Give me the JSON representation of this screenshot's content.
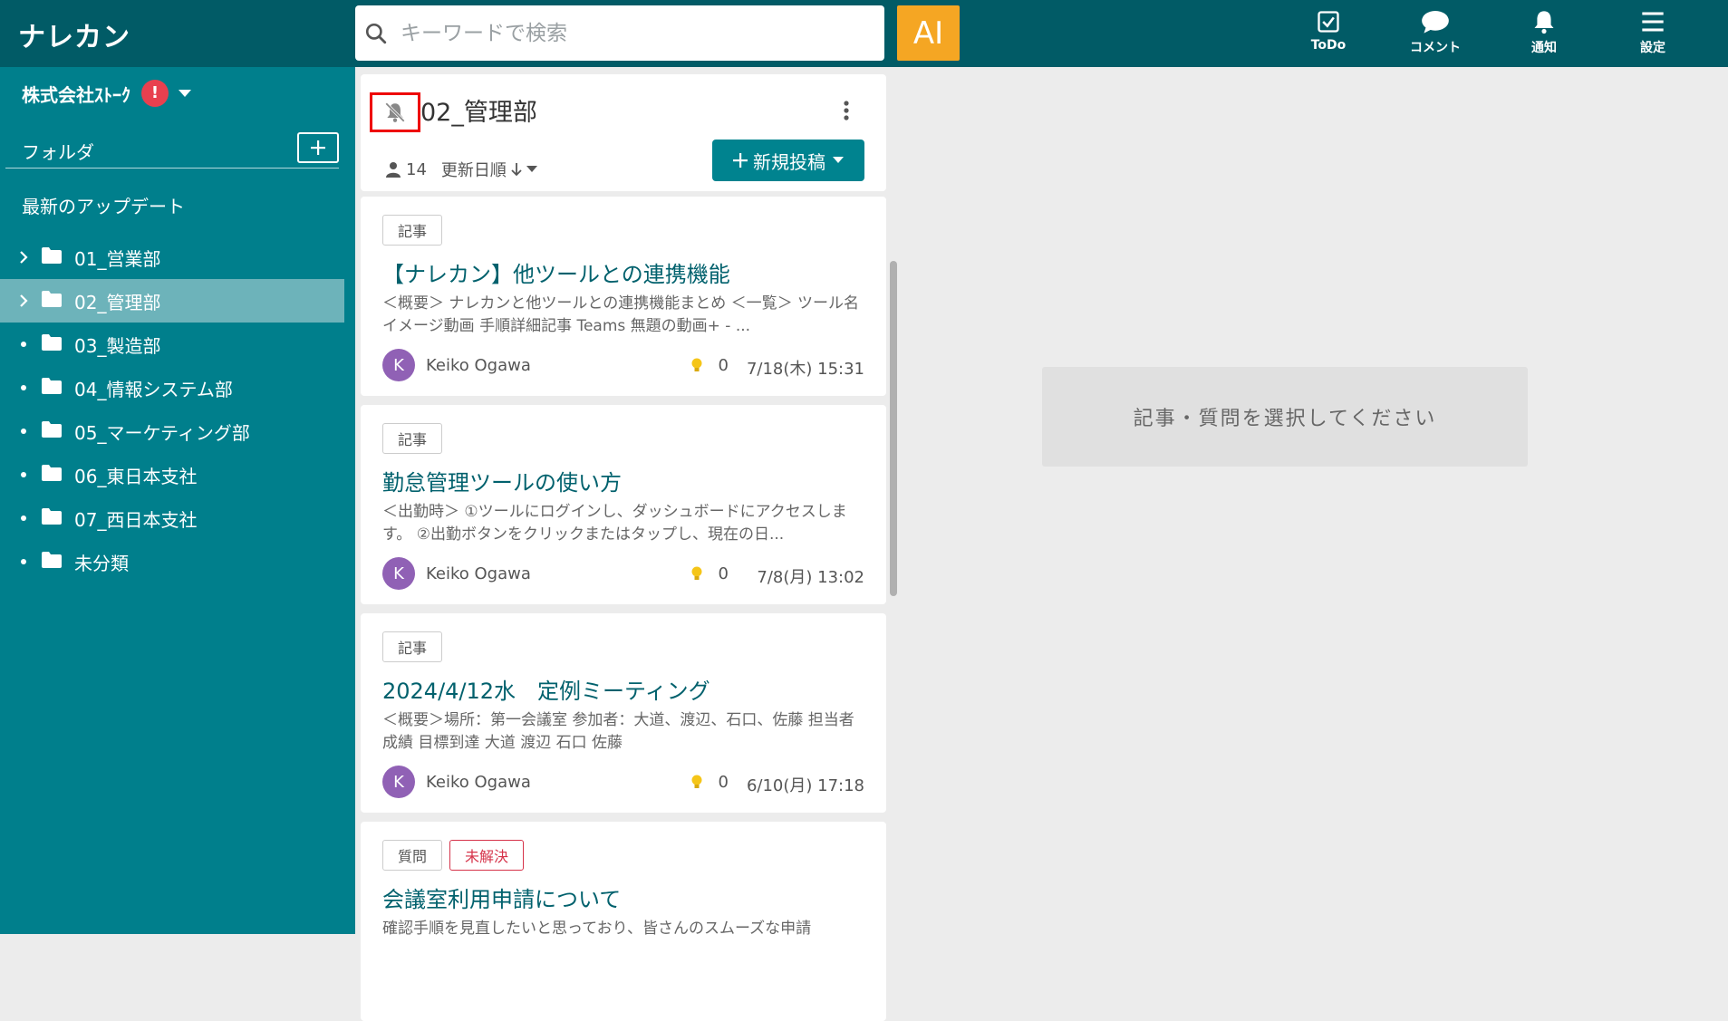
{
  "header": {
    "logo": "ナレカン",
    "search_placeholder": "キーワードで検索",
    "ai_label": "AI",
    "nav": [
      {
        "label": "ToDo",
        "icon": "todo-check-icon"
      },
      {
        "label": "コメント",
        "icon": "comment-bubble-icon"
      },
      {
        "label": "通知",
        "icon": "bell-icon"
      },
      {
        "label": "設定",
        "icon": "hamburger-menu-icon"
      }
    ]
  },
  "sidebar": {
    "company": "株式会社ｽﾄｰｸ",
    "alert_badge": "!",
    "folder_label": "フォルダ",
    "add_label": "+",
    "latest_updates": "最新のアップデート",
    "folders": [
      {
        "name": "01_営業部",
        "has_children": true,
        "active": false
      },
      {
        "name": "02_管理部",
        "has_children": true,
        "active": true
      },
      {
        "name": "03_製造部",
        "has_children": false,
        "active": false
      },
      {
        "name": "04_情報システム部",
        "has_children": false,
        "active": false
      },
      {
        "name": "05_マーケティング部",
        "has_children": false,
        "active": false
      },
      {
        "name": "06_東日本支社",
        "has_children": false,
        "active": false
      },
      {
        "name": "07_西日本支社",
        "has_children": false,
        "active": false
      },
      {
        "name": "未分類",
        "has_children": false,
        "active": false
      }
    ]
  },
  "folder_panel": {
    "title": "02_管理部",
    "member_count": "14",
    "sort_label": "更新日順",
    "new_post_label": "新規投稿"
  },
  "posts": [
    {
      "tags": [
        "記事"
      ],
      "title": "【ナレカン】他ツールとの連携機能",
      "excerpt": "＜概要＞ ナレカンと他ツールとの連携機能まとめ ＜一覧＞ ツール名 イメージ動画 手順詳細記事 Teams 無題の動画+ - ...",
      "author_initial": "K",
      "author": "Keiko Ogawa",
      "likes": "0",
      "date": "7/18(木) 15:31"
    },
    {
      "tags": [
        "記事"
      ],
      "title": "勤怠管理ツールの使い方",
      "excerpt": "＜出勤時＞ ①ツールにログインし、ダッシュボードにアクセスします。 ②出勤ボタンをクリックまたはタップし、現在の日...",
      "author_initial": "K",
      "author": "Keiko Ogawa",
      "likes": "0",
      "date": "7/8(月) 13:02"
    },
    {
      "tags": [
        "記事"
      ],
      "title": "2024/4/12水　定例ミーティング",
      "excerpt": "＜概要＞場所：第一会議室 参加者：大道、渡辺、石口、佐藤 担当者 成績 目標到達 大道 渡辺 石口 佐藤",
      "author_initial": "K",
      "author": "Keiko Ogawa",
      "likes": "0",
      "date": "6/10(月) 17:18"
    },
    {
      "tags": [
        "質問",
        "未解決"
      ],
      "title": "会議室利用申請について",
      "excerpt": "確認手順を見直したいと思っており、皆さんのスムーズな申請",
      "author_initial": "",
      "author": "",
      "likes": "",
      "date": ""
    }
  ],
  "detail": {
    "empty_message": "記事・質問を選択してください"
  },
  "colors": {
    "header_bg": "#015b66",
    "sidebar_bg": "#007f8c",
    "sidebar_active": "#6db3ba",
    "ai_button": "#f5a623",
    "primary_button": "#00838f",
    "avatar": "#9061b5",
    "unresolved": "#d6334a"
  }
}
